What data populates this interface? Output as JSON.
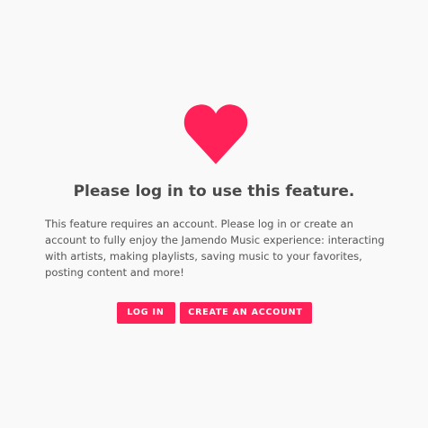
{
  "feature_gate": {
    "icon": "heart-icon",
    "accent_color": "#ff2158",
    "title": "Please log in to use this feature.",
    "description": "This feature requires an account. Please log in or create an account to fully enjoy the Jamendo Music experience: interacting with artists, making playlists, saving music to your favorites, posting content and more!",
    "login_label": "LOG IN",
    "create_account_label": "CREATE AN ACCOUNT"
  }
}
